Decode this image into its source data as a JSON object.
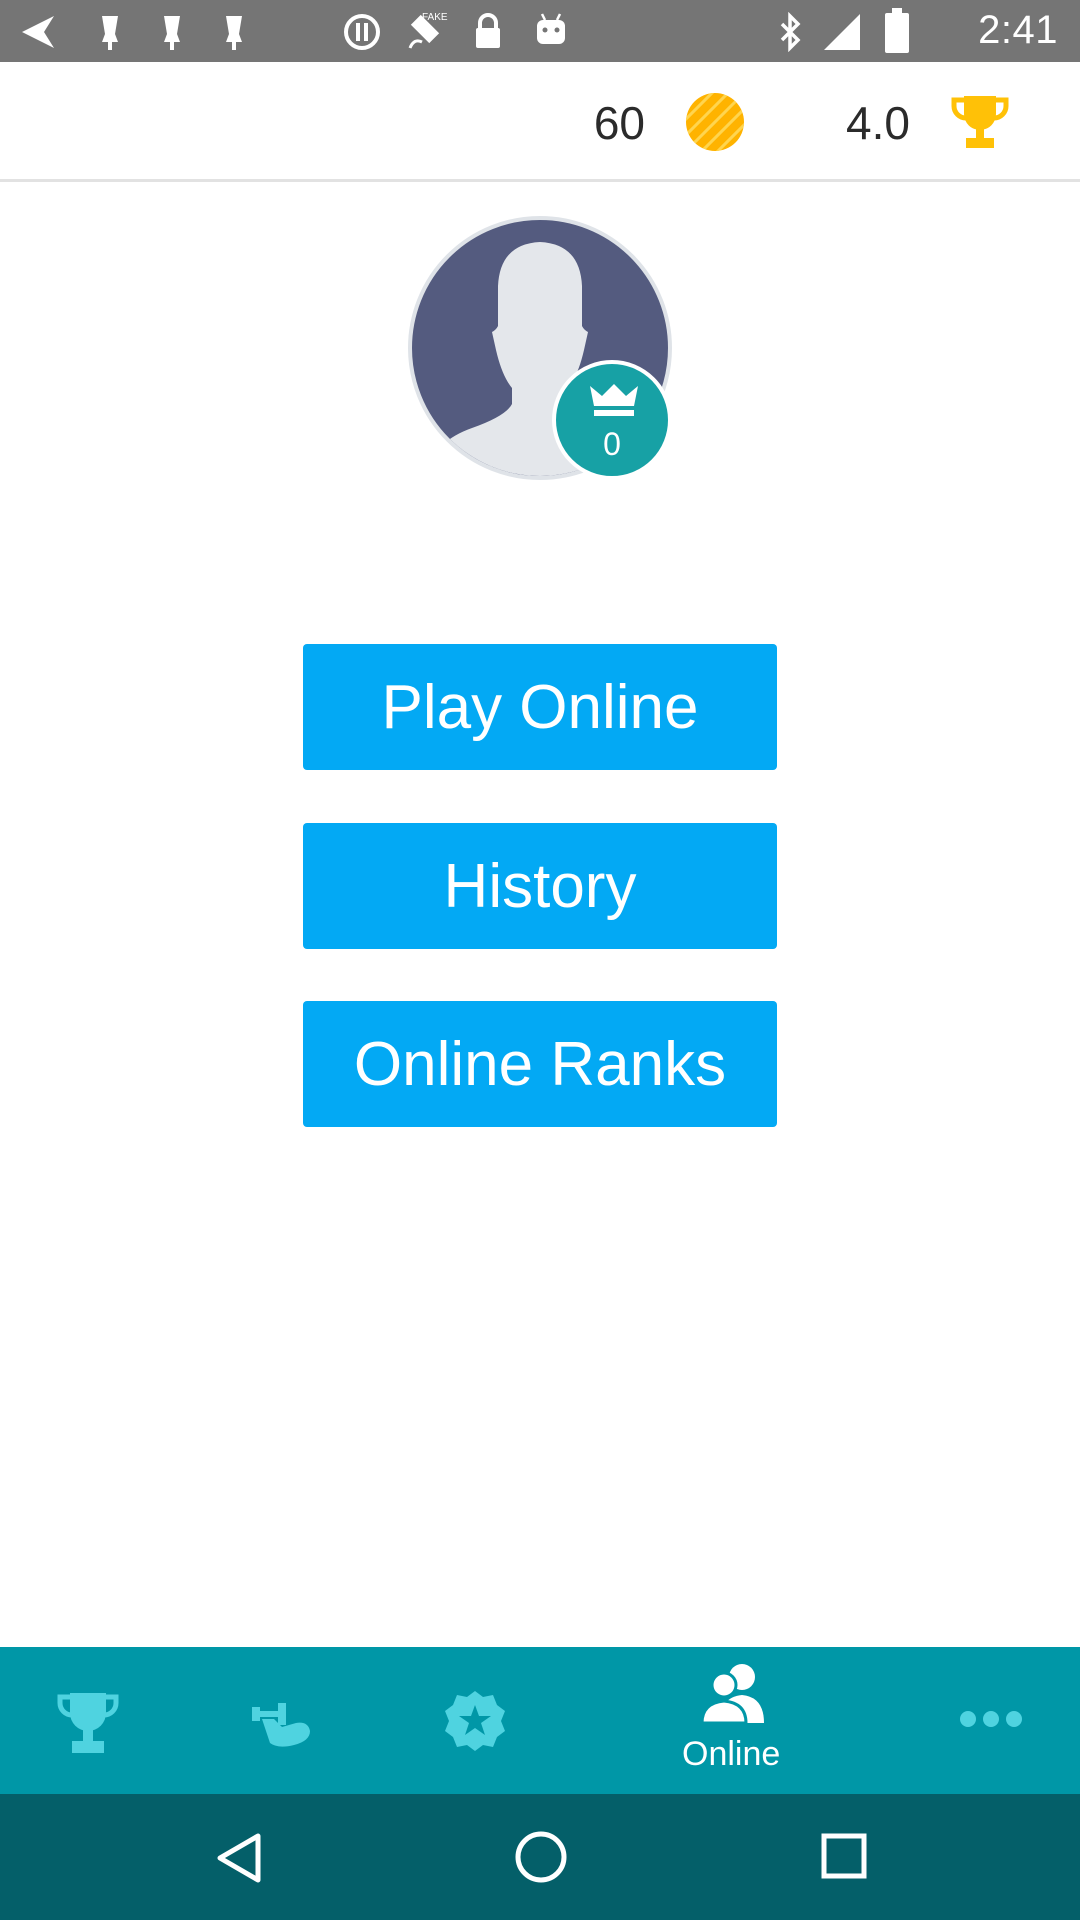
{
  "status_bar": {
    "time": "2:41",
    "icons": [
      "navigation-icon",
      "alarm-icon",
      "alarm-icon",
      "alarm-icon",
      "info-icon",
      "satellite-icon",
      "lock-icon",
      "android-icon",
      "bluetooth-icon",
      "signal-icon",
      "battery-icon"
    ]
  },
  "header": {
    "coins": "60",
    "rating": "4.0",
    "coin_color": "#ffb300",
    "trophy_color": "#ffc107"
  },
  "profile": {
    "rank": "0",
    "avatar_color": "#545b7f",
    "badge_color": "#17a1a5"
  },
  "menu": {
    "play_online": "Play Online",
    "history": "History",
    "online_ranks": "Online Ranks",
    "button_color": "#03a9f4"
  },
  "bottom_nav": {
    "items": [
      {
        "icon": "trophy-icon",
        "label": ""
      },
      {
        "icon": "muscle-icon",
        "label": ""
      },
      {
        "icon": "badge-star-icon",
        "label": ""
      },
      {
        "icon": "users-icon",
        "label": "Online",
        "active": true
      },
      {
        "icon": "more-icon",
        "label": ""
      }
    ],
    "bg_color": "#0097a7",
    "icon_color": "#4fd3e0"
  },
  "system_nav": {
    "buttons": [
      "back-icon",
      "home-icon",
      "recents-icon"
    ],
    "bg_color": "#045f69"
  }
}
